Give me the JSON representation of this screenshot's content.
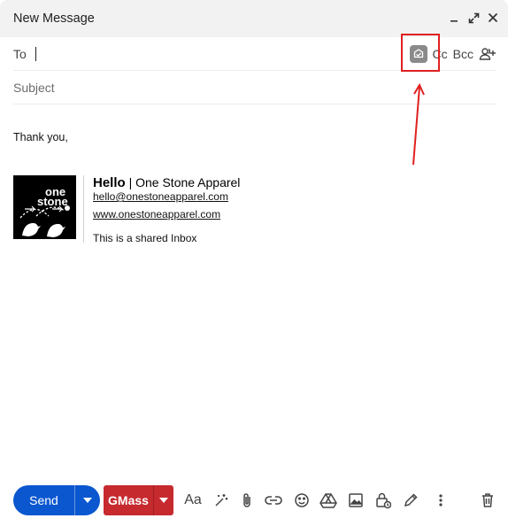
{
  "window": {
    "title": "New Message",
    "controls": [
      "minimize-icon",
      "expand-icon",
      "close-icon"
    ]
  },
  "recipients": {
    "to_label": "To",
    "to_value": "",
    "extension_icon": "mailtrack-icon",
    "cc_label": "Cc",
    "bcc_label": "Bcc",
    "contacts_icon": "add-recipients-icon"
  },
  "subject": {
    "placeholder": "Subject",
    "value": ""
  },
  "body": {
    "text": "Thank you,"
  },
  "signature": {
    "logo_line1": "one",
    "logo_line2": "stone",
    "name": "Hello",
    "separator": "|",
    "company": "One Stone Apparel",
    "email": "hello@onestoneapparel.com",
    "website": "www.onestoneapparel.com",
    "note": "This is a shared Inbox"
  },
  "toolbar": {
    "send_label": "Send",
    "gmass_label": "GMass",
    "format_label": "Aa",
    "tools": [
      "ai-write-icon",
      "attach-icon",
      "link-icon",
      "emoji-icon",
      "drive-icon",
      "photo-icon",
      "confidential-icon",
      "signature-icon",
      "more-options-icon",
      "discard-icon"
    ]
  },
  "colors": {
    "send": "#0b57d0",
    "gmass": "#c62a2f",
    "annotation": "#e02020"
  }
}
